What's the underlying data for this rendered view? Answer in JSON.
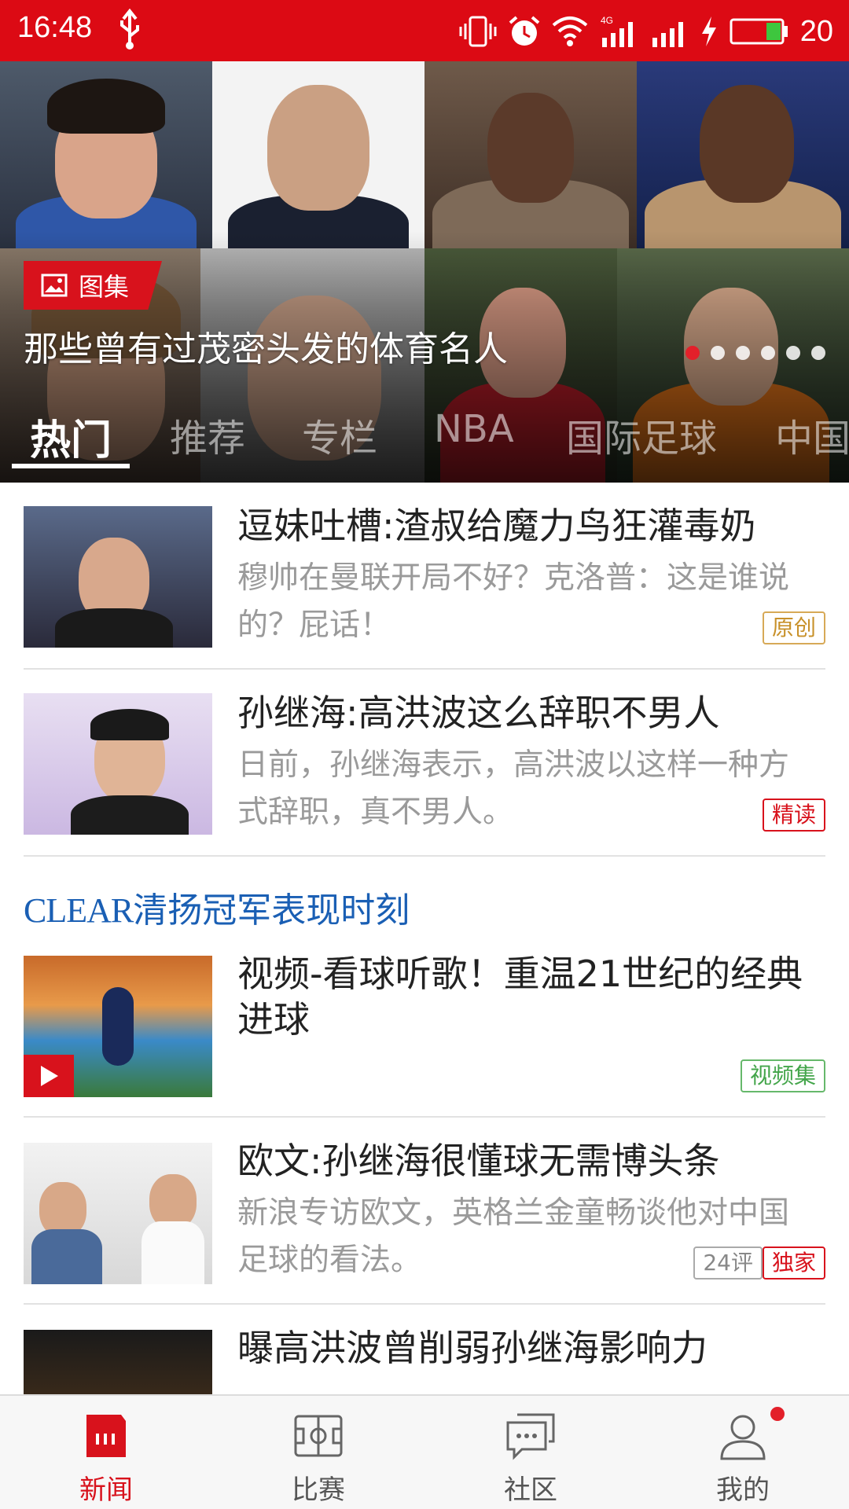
{
  "status_bar": {
    "time": "16:48",
    "battery_percent": "20",
    "network": "4G",
    "icons": [
      "usb-icon",
      "vibrate-icon",
      "alarm-icon",
      "wifi-icon",
      "signal-4g-icon",
      "signal-icon",
      "charging-icon",
      "battery-icon"
    ]
  },
  "hero": {
    "badge_label": "图集",
    "badge_icon": "image-icon",
    "caption": "那些曾有过茂密头发的体育名人",
    "slide_count": 6,
    "active_slide": 1
  },
  "tabs": [
    "热门",
    "推荐",
    "专栏",
    "NBA",
    "国际足球",
    "中国"
  ],
  "active_tab": "热门",
  "feed": {
    "items": [
      {
        "title": "逗妹吐槽:渣叔给魔力鸟狂灌毒奶",
        "desc": "穆帅在曼联开局不好？克洛普：这是谁说的？屁话！",
        "tag": "原创"
      },
      {
        "title": "孙继海:高洪波这么辞职不男人",
        "desc": "日前，孙继海表示，高洪波以这样一种方式辞职，真不男人。",
        "tag": "精读"
      },
      {
        "title": "视频-看球听歌！重温21世纪的经典进球",
        "desc": "",
        "tag": "视频集"
      },
      {
        "title": "欧文:孙继海很懂球无需博头条",
        "desc": "新浪专访欧文，英格兰金童畅谈他对中国足球的看法。",
        "comments": "24评",
        "tag": "独家"
      },
      {
        "title": "曝高洪波曾削弱孙继海影响力",
        "desc": ""
      }
    ],
    "sponsor": {
      "brand": "CLEAR",
      "text": "清扬冠军表现时刻"
    }
  },
  "bottom_nav": [
    {
      "label": "新闻",
      "icon": "news-icon"
    },
    {
      "label": "比赛",
      "icon": "match-icon"
    },
    {
      "label": "社区",
      "icon": "community-icon"
    },
    {
      "label": "我的",
      "icon": "profile-icon"
    }
  ],
  "active_nav": "新闻",
  "colors": {
    "brand_red": "#dc0a14",
    "sponsor_blue": "#1a5fb4",
    "tag_original": "#c8912a",
    "tag_video": "#43a54a"
  }
}
